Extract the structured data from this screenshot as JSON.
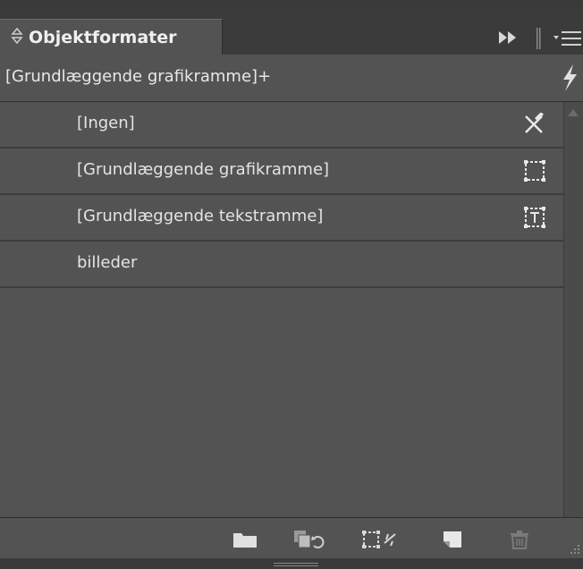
{
  "panel": {
    "title": "Objektformater",
    "current_style": "[Grundlæggende grafikramme]+"
  },
  "styles": [
    {
      "label": "[Ingen]",
      "icon": "none-style-icon"
    },
    {
      "label": "[Grundlæggende grafikramme]",
      "icon": "graphic-frame-icon"
    },
    {
      "label": "[Grundlæggende tekstramme]",
      "icon": "text-frame-icon"
    },
    {
      "label": "billeder",
      "icon": ""
    }
  ],
  "colors": {
    "panel_bg": "#535353",
    "tab_bar_bg": "#3b3b3b",
    "divider": "#3d3d3d",
    "text": "#e4e4e4"
  },
  "icons": {
    "tab": "expand-collapse-arrows-icon",
    "toolbar": [
      "fast-forward-icon",
      "panel-menu-icon",
      "quick-apply-lightning-icon"
    ],
    "bottom": [
      "new-style-group-icon",
      "load-styles-icon",
      "clear-overrides-icon",
      "new-style-icon",
      "delete-style-icon"
    ]
  }
}
